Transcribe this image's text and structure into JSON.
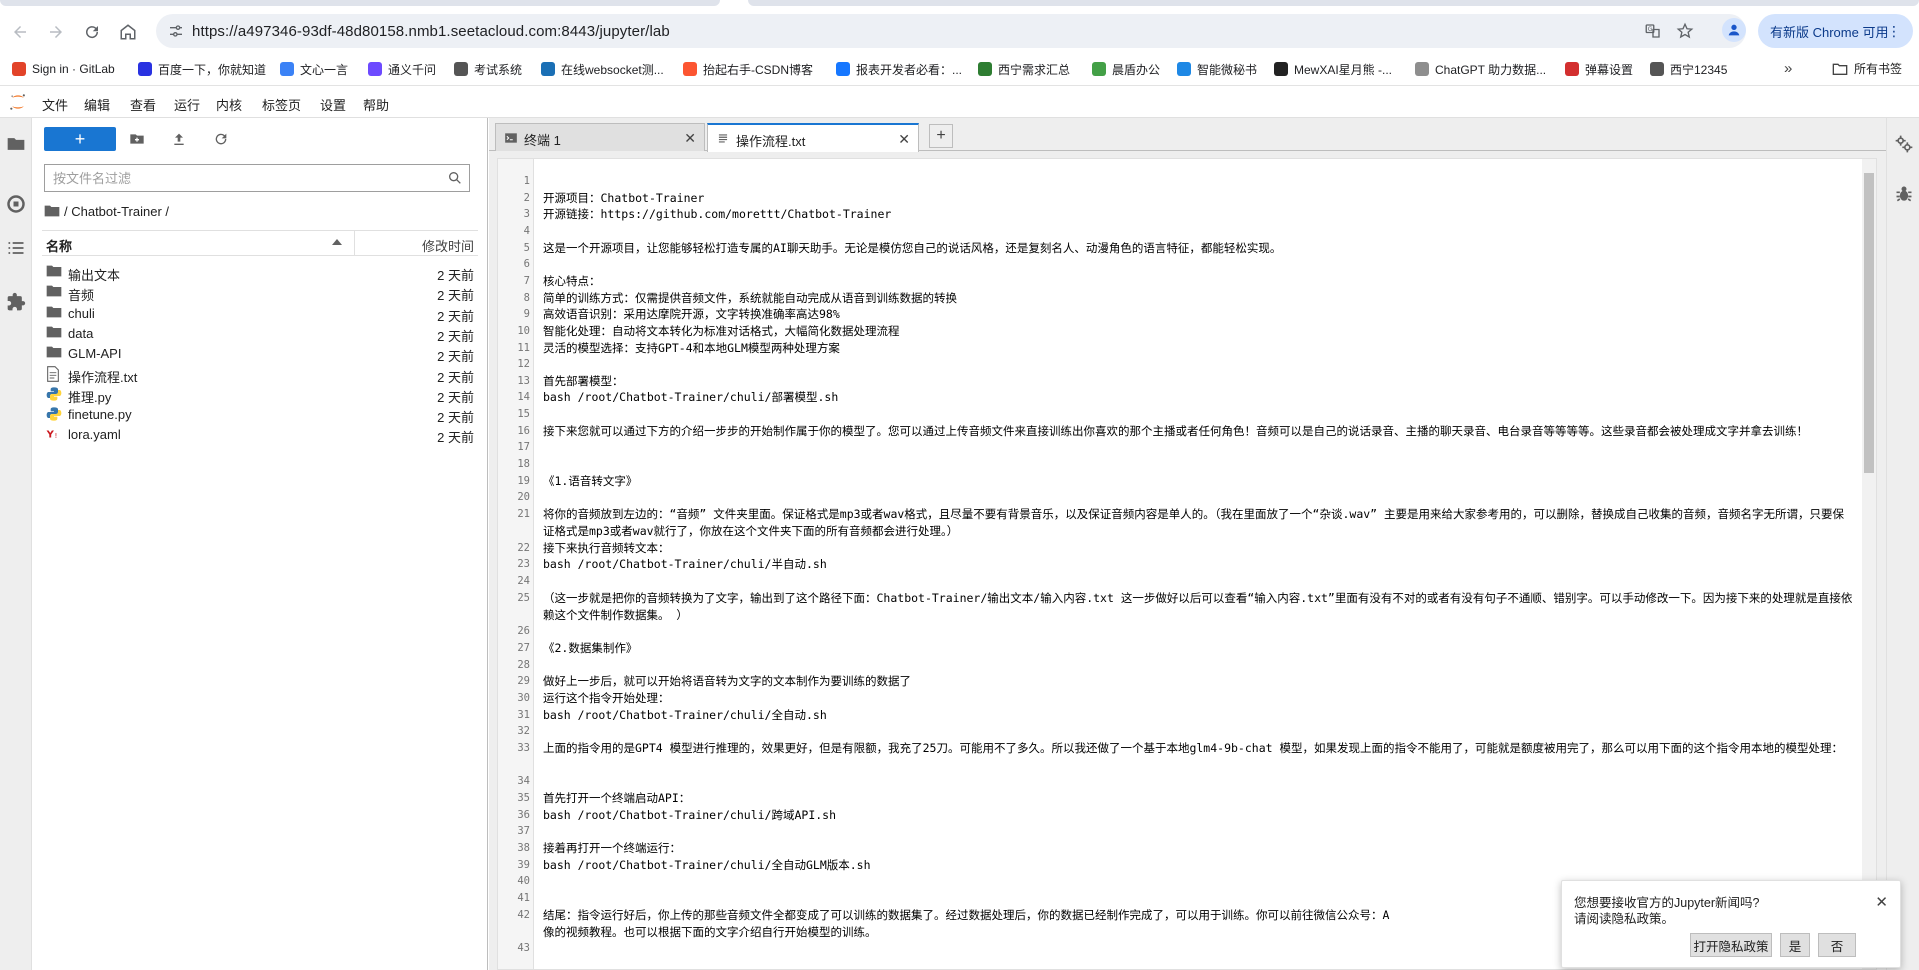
{
  "browser": {
    "url": "https://a497346-93df-48d80158.nmb1.seetacloud.com:8443/jupyter/lab",
    "update_label": "有新版 Chrome 可用",
    "bookmarks": [
      {
        "label": "Sign in · GitLab",
        "color": "#e24329"
      },
      {
        "label": "百度一下，你就知道",
        "color": "#2932e1"
      },
      {
        "label": "文心一言",
        "color": "#3b82f6"
      },
      {
        "label": "通义千问",
        "color": "#6d4aff"
      },
      {
        "label": "考试系统",
        "color": "#555555"
      },
      {
        "label": "在线websocket测...",
        "color": "#1a6fb5"
      },
      {
        "label": "抬起右手-CSDN博客",
        "color": "#fc5531"
      },
      {
        "label": "报表开发者必看：...",
        "color": "#1677ff"
      },
      {
        "label": "西宁需求汇总",
        "color": "#2e7d32"
      },
      {
        "label": "晨盾办公",
        "color": "#43a047"
      },
      {
        "label": "智能微秘书",
        "color": "#1e88e5"
      },
      {
        "label": "MewXAI星月熊 -...",
        "color": "#222222"
      },
      {
        "label": "ChatGPT 助力数据...",
        "color": "#8e8e8e"
      },
      {
        "label": "弹幕设置",
        "color": "#d32f2f"
      },
      {
        "label": "西宁12345",
        "color": "#555555"
      }
    ],
    "all_bookmarks": "所有书签"
  },
  "menu": [
    "文件",
    "编辑",
    "查看",
    "运行",
    "内核",
    "标签页",
    "设置",
    "帮助"
  ],
  "filebrowser": {
    "filter_placeholder": "按文件名过滤",
    "breadcrumb": "/ Chatbot-Trainer /",
    "col_name": "名称",
    "col_modified": "修改时间",
    "items": [
      {
        "name": "输出文本",
        "type": "folder",
        "modified": "2 天前"
      },
      {
        "name": "音频",
        "type": "folder",
        "modified": "2 天前"
      },
      {
        "name": "chuli",
        "type": "folder",
        "modified": "2 天前"
      },
      {
        "name": "data",
        "type": "folder",
        "modified": "2 天前"
      },
      {
        "name": "GLM-API",
        "type": "folder",
        "modified": "2 天前"
      },
      {
        "name": "操作流程.txt",
        "type": "text",
        "modified": "2 天前"
      },
      {
        "name": "推理.py",
        "type": "python",
        "modified": "2 天前"
      },
      {
        "name": "finetune.py",
        "type": "python",
        "modified": "2 天前"
      },
      {
        "name": "lora.yaml",
        "type": "yaml",
        "modified": "2 天前"
      }
    ]
  },
  "tabs": [
    {
      "label": "终端 1",
      "active": false
    },
    {
      "label": "操作流程.txt",
      "active": true
    }
  ],
  "editor_lines": [
    {
      "n": "1",
      "t": ""
    },
    {
      "n": "2",
      "t": "开源项目：Chatbot-Trainer"
    },
    {
      "n": "3",
      "t": "开源链接：https://github.com/morettt/Chatbot-Trainer"
    },
    {
      "n": "4",
      "t": ""
    },
    {
      "n": "5",
      "t": "这是一个开源项目，让您能够轻松打造专属的AI聊天助手。无论是模仿您自己的说话风格，还是复刻名人、动漫角色的语言特征，都能轻松实现。"
    },
    {
      "n": "6",
      "t": ""
    },
    {
      "n": "7",
      "t": "核心特点："
    },
    {
      "n": "8",
      "t": "简单的训练方式：仅需提供音频文件，系统就能自动完成从语音到训练数据的转换"
    },
    {
      "n": "9",
      "t": "高效语音识别：采用达摩院开源，文字转换准确率高达98%"
    },
    {
      "n": "10",
      "t": "智能化处理：自动将文本转化为标准对话格式，大幅简化数据处理流程"
    },
    {
      "n": "11",
      "t": "灵活的模型选择：支持GPT-4和本地GLM模型两种处理方案"
    },
    {
      "n": "12",
      "t": ""
    },
    {
      "n": "13",
      "t": "首先部署模型："
    },
    {
      "n": "14",
      "t": "bash /root/Chatbot-Trainer/chuli/部署模型.sh"
    },
    {
      "n": "15",
      "t": ""
    },
    {
      "n": "16",
      "t": "接下来您就可以通过下方的介绍一步步的开始制作属于你的模型了。您可以通过上传音频文件来直接训练出你喜欢的那个主播或者任何角色！音频可以是自己的说话录音、主播的聊天录音、电台录音等等等等。这些录音都会被处理成文字并拿去训练！"
    },
    {
      "n": "17",
      "t": ""
    },
    {
      "n": "18",
      "t": ""
    },
    {
      "n": "19",
      "t": "《1.语音转文字》"
    },
    {
      "n": "20",
      "t": ""
    },
    {
      "n": "21",
      "t": "将你的音频放到左边的：“音频” 文件夹里面。保证格式是mp3或者wav格式，且尽量不要有背景音乐，以及保证音频内容是单人的。（我在里面放了一个“杂谈.wav” 主要是用来给大家参考用的，可以删除，替换成自己收集的音频，音频名字无所谓，只要保证格式是mp3或者wav就行了，你放在这个文件夹下面的所有音频都会进行处理。）"
    },
    {
      "n": "22",
      "t": "接下来执行音频转文本："
    },
    {
      "n": "23",
      "t": "bash /root/Chatbot-Trainer/chuli/半自动.sh"
    },
    {
      "n": "24",
      "t": ""
    },
    {
      "n": "25",
      "t": "（这一步就是把你的音频转换为了文字，输出到了这个路径下面：Chatbot-Trainer/输出文本/输入内容.txt 这一步做好以后可以查看“输入内容.txt”里面有没有不对的或者有没有句子不通顺、错别字。可以手动修改一下。因为接下来的处理就是直接依赖这个文件制作数据集。 ）"
    },
    {
      "n": "26",
      "t": ""
    },
    {
      "n": "27",
      "t": "《2.数据集制作》"
    },
    {
      "n": "28",
      "t": ""
    },
    {
      "n": "29",
      "t": "做好上一步后，就可以开始将语音转为文字的文本制作为要训练的数据了"
    },
    {
      "n": "30",
      "t": "运行这个指令开始处理："
    },
    {
      "n": "31",
      "t": "bash /root/Chatbot-Trainer/chuli/全自动.sh"
    },
    {
      "n": "32",
      "t": ""
    },
    {
      "n": "33",
      "t": "上面的指令用的是GPT4 模型进行推理的，效果更好，但是有限额，我充了25刀。可能用不了多久。所以我还做了一个基于本地glm4-9b-chat 模型，如果发现上面的指令不能用了，可能就是额度被用完了，那么可以用下面的这个指令用本地的模型处理："
    },
    {
      "n": "34",
      "t": ""
    },
    {
      "n": "35",
      "t": "首先打开一个终端启动API："
    },
    {
      "n": "36",
      "t": "bash /root/Chatbot-Trainer/chuli/跨域API.sh"
    },
    {
      "n": "37",
      "t": ""
    },
    {
      "n": "38",
      "t": "接着再打开一个终端运行："
    },
    {
      "n": "39",
      "t": "bash /root/Chatbot-Trainer/chuli/全自动GLM版本.sh"
    },
    {
      "n": "40",
      "t": ""
    },
    {
      "n": "41",
      "t": ""
    },
    {
      "n": "42",
      "t": "结尾：指令运行好后，你上传的那些音频文件全都变成了可以训练的数据集了。经过数据处理后，你的数据已经制作完成了，可以用于训练。你可以前往微信公众号：A                                                                                                                                像的视频教程。也可以根据下面的文字介绍自行开始模型的训练。"
    },
    {
      "n": "43",
      "t": ""
    }
  ],
  "toast": {
    "line1": "您想要接收官方的Jupyter新闻吗?",
    "line2": "请阅读隐私政策。",
    "btn_privacy": "打开隐私政策",
    "btn_yes": "是",
    "btn_no": "否"
  }
}
